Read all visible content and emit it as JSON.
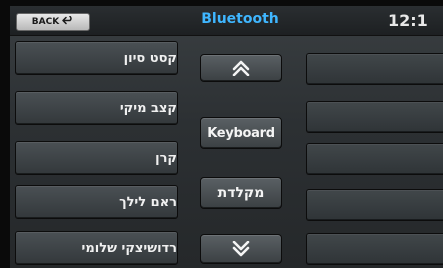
{
  "header": {
    "back_label": "BACK",
    "back_icon": "return-arrow-icon",
    "title": "Bluetooth",
    "clock": "12:1"
  },
  "contacts": [
    "קסט סיון",
    "קצב מיקי",
    "קרן",
    "ראם לילך",
    "רדושיצקי שלומי"
  ],
  "controls": {
    "scroll_up_icon": "double-chevron-up-icon",
    "keyboard_label": "Keyboard",
    "hebrew_keyboard_label": "מקלדת",
    "scroll_down_icon": "double-chevron-down-icon"
  },
  "colors": {
    "title": "#3fb6ff",
    "text": "#f0f0f0"
  }
}
